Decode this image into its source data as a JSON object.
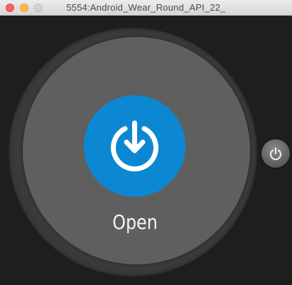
{
  "window": {
    "title": "5554:Android_Wear_Round_API_22_",
    "buttons": [
      "close",
      "minimize",
      "zoom"
    ]
  },
  "watch": {
    "action": {
      "label": "Open",
      "icon": "power-download-icon",
      "color": "#0c88d2"
    },
    "screen_color": "#5f5f5f",
    "bezel_color": "#3a3a3a"
  },
  "hardware": {
    "power_button_icon": "power-icon"
  }
}
